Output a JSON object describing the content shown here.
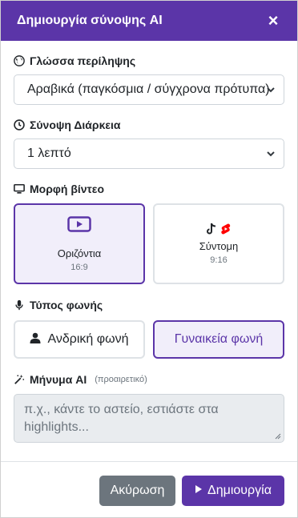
{
  "header": {
    "title": "Δημιουργία σύνοψης AI",
    "close_label": "×"
  },
  "language": {
    "label": "Γλώσσα περίληψης",
    "icon": "globe-icon",
    "selected": "Αραβικά (παγκόσμια / σύγχρονα πρότυπα)"
  },
  "duration": {
    "label": "Σύνοψη Διάρκεια",
    "icon": "clock-icon",
    "selected": "1 λεπτό"
  },
  "format": {
    "label": "Μορφή βίντεο",
    "icon": "monitor-icon",
    "options": [
      {
        "name": "Οριζόντια",
        "ratio": "16:9",
        "icon": "youtube-icon",
        "selected": true
      },
      {
        "name": "Σύντομη",
        "ratio": "9:16",
        "icon": "tiktok-shorts-icon",
        "selected": false
      }
    ]
  },
  "voice": {
    "label": "Τύπος φωνής",
    "icon": "microphone-icon",
    "options": [
      {
        "name": "Ανδρική φωνή",
        "icon": "user-icon",
        "selected": false
      },
      {
        "name": "Γυναικεία φωνή",
        "selected": true
      }
    ]
  },
  "message": {
    "label": "Μήνυμα AI",
    "optional": "(προαιρετικό)",
    "icon": "magic-wand-icon",
    "placeholder": "π.χ., κάντε το αστείο, εστιάστε στα highlights..."
  },
  "footer": {
    "cancel_label": "Ακύρωση",
    "create_label": "Δημιουργία"
  },
  "colors": {
    "accent": "#5b35a8",
    "accent_bg": "#f1eefa",
    "cancel": "#6c757d",
    "tiktok": "#212529",
    "shorts_red": "#ff0000"
  }
}
